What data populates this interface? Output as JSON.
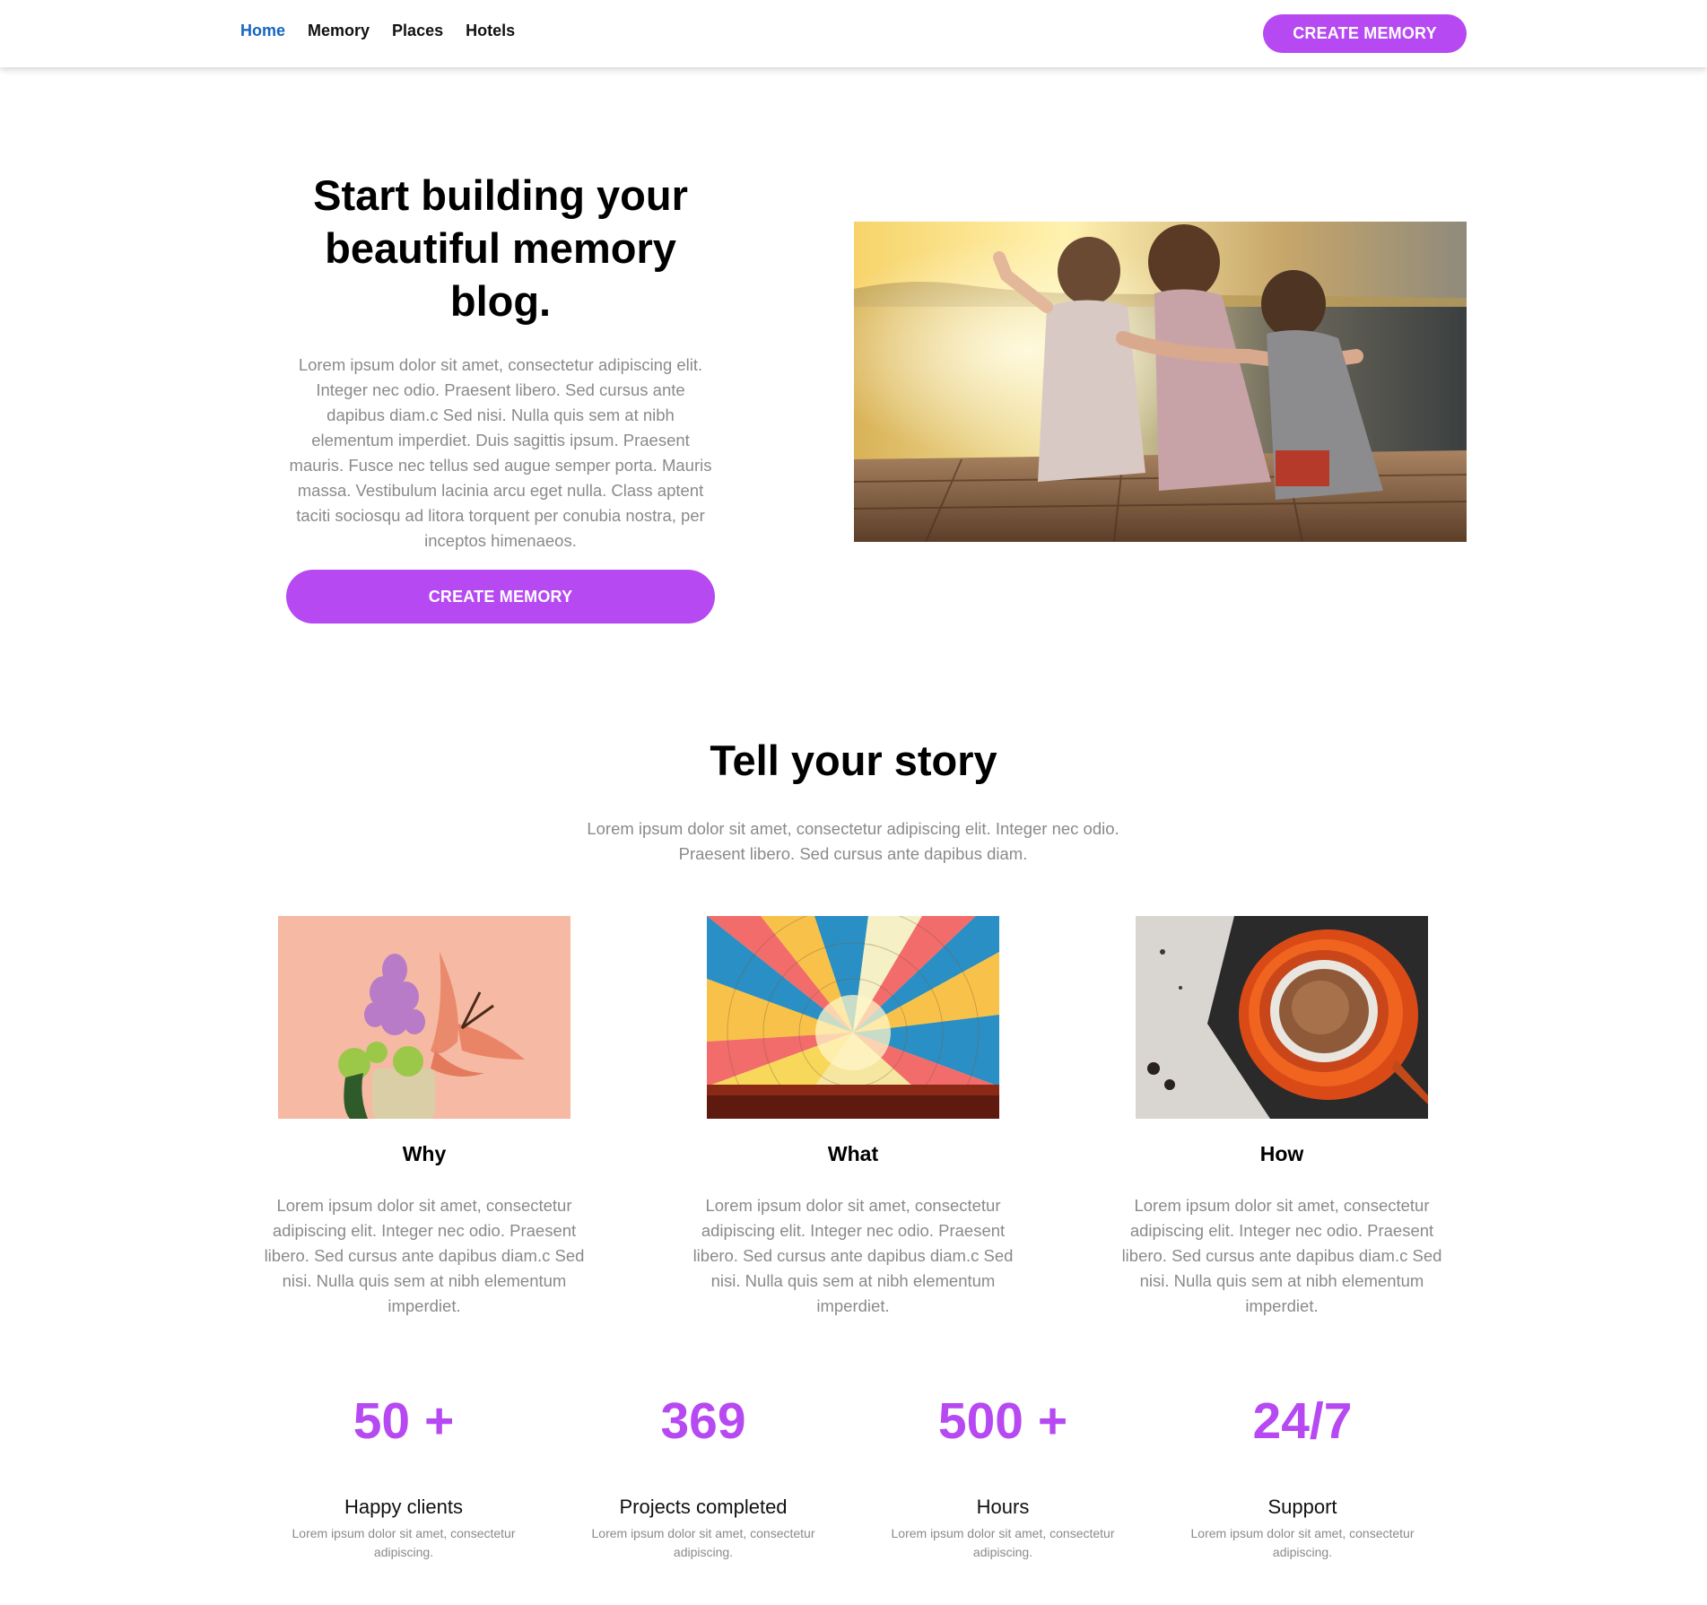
{
  "nav": {
    "items": [
      {
        "label": "Home",
        "active": true
      },
      {
        "label": "Memory",
        "active": false
      },
      {
        "label": "Places",
        "active": false
      },
      {
        "label": "Hotels",
        "active": false
      }
    ],
    "cta_label": "CREATE MEMORY"
  },
  "hero": {
    "title": "Start building your beautiful memory blog.",
    "body": "Lorem ipsum dolor sit amet, consectetur adipiscing elit. Integer nec odio. Praesent libero. Sed cursus ante dapibus diam.c Sed nisi. Nulla quis sem at nibh elementum imperdiet. Duis sagittis ipsum. Praesent mauris. Fusce nec tellus sed augue semper porta. Mauris massa. Vestibulum lacinia arcu eget nulla. Class aptent taciti sociosqu ad litora torquent per conubia nostra, per inceptos himenaeos.",
    "cta_label": "CREATE MEMORY"
  },
  "story": {
    "title": "Tell your story",
    "subtitle": "Lorem ipsum dolor sit amet, consectetur adipiscing elit. Integer nec odio. Praesent libero. Sed cursus ante dapibus diam.",
    "cards": [
      {
        "title": "Why",
        "body": "Lorem ipsum dolor sit amet, consectetur adipiscing elit. Integer nec odio. Praesent libero. Sed cursus ante dapibus diam.c Sed nisi. Nulla quis sem at nibh elementum imperdiet."
      },
      {
        "title": "What",
        "body": "Lorem ipsum dolor sit amet, consectetur adipiscing elit. Integer nec odio. Praesent libero. Sed cursus ante dapibus diam.c Sed nisi. Nulla quis sem at nibh elementum imperdiet."
      },
      {
        "title": "How",
        "body": "Lorem ipsum dolor sit amet, consectetur adipiscing elit. Integer nec odio. Praesent libero. Sed cursus ante dapibus diam.c Sed nisi. Nulla quis sem at nibh elementum imperdiet."
      }
    ]
  },
  "stats": [
    {
      "value": "50 +",
      "label": "Happy clients",
      "desc": "Lorem ipsum dolor sit amet, consectetur adipiscing."
    },
    {
      "value": "369",
      "label": "Projects completed",
      "desc": "Lorem ipsum dolor sit amet, consectetur adipiscing."
    },
    {
      "value": "500 +",
      "label": "Hours",
      "desc": "Lorem ipsum dolor sit amet, consectetur adipiscing."
    },
    {
      "value": "24/7",
      "label": "Support",
      "desc": "Lorem ipsum dolor sit amet, consectetur adipiscing."
    }
  ],
  "colors": {
    "accent": "#b649f2",
    "nav_active": "#1565c0",
    "body_text": "#8a8a8a"
  }
}
